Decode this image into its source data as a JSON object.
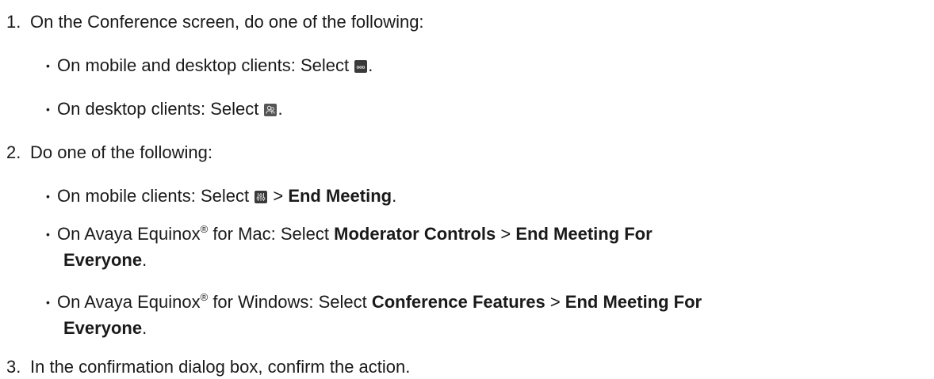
{
  "steps": [
    {
      "number": "1.",
      "text": "On the Conference screen, do one of the following:",
      "bullets": [
        {
          "pre": "On mobile and desktop clients: Select ",
          "icon": "more-options-icon",
          "post": "."
        },
        {
          "pre": "On desktop clients: Select ",
          "icon": "participants-icon",
          "post": "."
        }
      ]
    },
    {
      "number": "2.",
      "text": "Do one of the following:",
      "bullets": [
        {
          "pre": "On mobile clients: Select ",
          "icon": "moderator-controls-icon",
          "mid": " > ",
          "bold1": "End Meeting",
          "post": "."
        },
        {
          "pre": "On Avaya Equinox",
          "reg": "®",
          "mid1": " for Mac: Select ",
          "bold1": "Moderator Controls",
          "mid2": " > ",
          "bold2a": "End Meeting For",
          "bold2b": "Everyone",
          "post": "."
        },
        {
          "pre": "On Avaya Equinox",
          "reg": "®",
          "mid1": " for Windows: Select ",
          "bold1": "Conference Features",
          "mid2": " > ",
          "bold2a": "End Meeting For",
          "bold2b": "Everyone",
          "post": "."
        }
      ]
    },
    {
      "number": "3.",
      "text": "In the confirmation dialog box, confirm the action."
    }
  ]
}
